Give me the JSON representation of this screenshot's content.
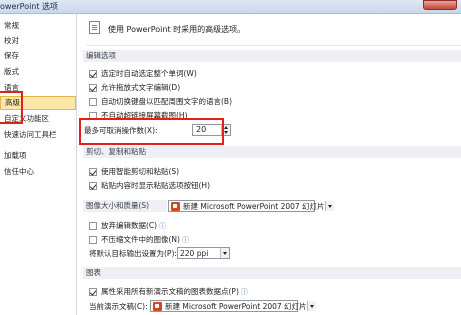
{
  "window": {
    "title": "owerPoint 选项"
  },
  "sidebar": {
    "items": [
      {
        "label": "常规"
      },
      {
        "label": "校对"
      },
      {
        "label": "保存"
      },
      {
        "label": "版式"
      },
      {
        "label": "语言"
      },
      {
        "label": "高级"
      },
      {
        "label": "自定义功能区"
      },
      {
        "label": "快速访问工具栏"
      },
      {
        "label": "加载项"
      },
      {
        "label": "信任中心"
      }
    ]
  },
  "main": {
    "header_text": "使用 PowerPoint 时采用的高级选项。",
    "sections": {
      "editing": "编辑选项",
      "clipboard": "剪切、复制和粘贴",
      "image": "图像大小和质量(S)",
      "chart": "图表"
    },
    "editing_options": [
      {
        "label": "选定时自动选定整个单词(W)",
        "checked": true
      },
      {
        "label": "允许拖放式文字编辑(D)",
        "checked": true
      },
      {
        "label": "自动切换键盘以匹配周围文字的语言(B)",
        "checked": false
      },
      {
        "label": "不自动超链接屏幕截图(H)",
        "checked": false
      }
    ],
    "undo": {
      "label": "最多可取消操作数(X):",
      "value": "20"
    },
    "clipboard_options": [
      {
        "label": "使用智能剪切和粘贴(S)",
        "checked": true
      },
      {
        "label": "粘贴内容时显示粘贴选项按钮(H)",
        "checked": true
      }
    ],
    "image_file": "新建 Microsoft PowerPoint 2007 幻灯片",
    "image_options": [
      {
        "label": "放弃编辑数据(C)",
        "checked": false
      },
      {
        "label": "不压缩文件中的图像(N)",
        "checked": false
      }
    ],
    "resolution": {
      "label": "将默认目标输出设置为(P):",
      "value": "220 ppi"
    },
    "chart_options": [
      {
        "label": "属性采用所有新演示文稿的图表数据点(P)",
        "checked": true
      }
    ],
    "current_doc": {
      "label": "当前演示文稿(C):",
      "value": "新建 Microsoft PowerPoint 2007 幻灯片"
    }
  }
}
